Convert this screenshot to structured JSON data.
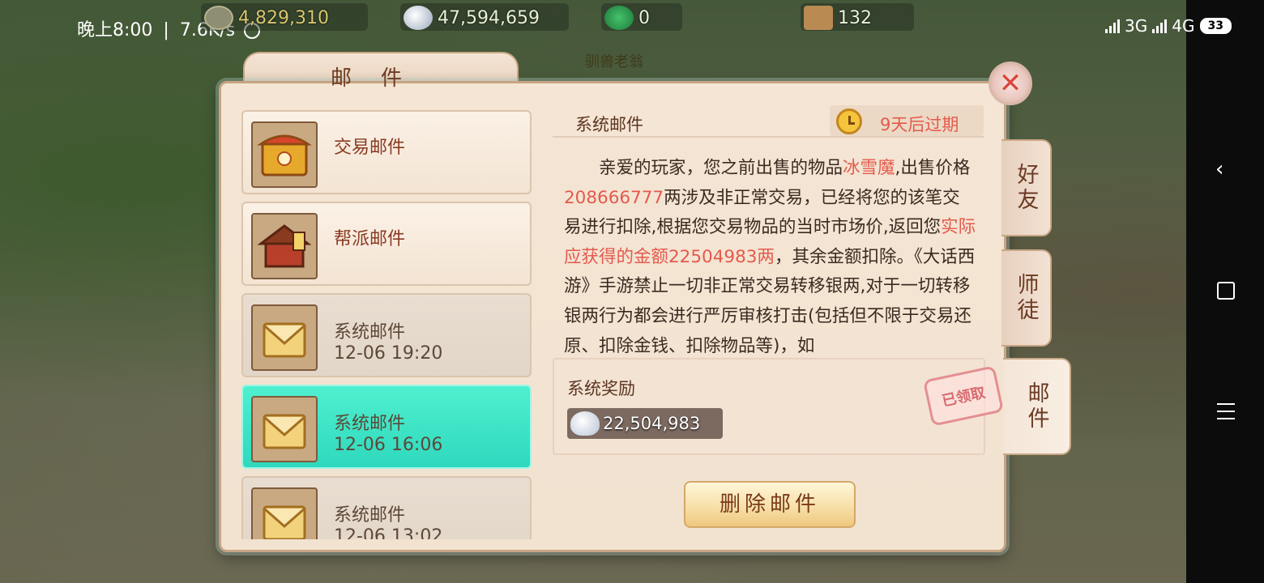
{
  "status_bar": {
    "time": "晚上8:00",
    "separator": "|",
    "speed": "7.6K/s",
    "net1": "3G",
    "net2": "4G",
    "battery": "33"
  },
  "currencies": [
    {
      "icon": "coin-icon",
      "value": "4,829,310"
    },
    {
      "icon": "silver-ingot-icon",
      "value": "47,594,659"
    },
    {
      "icon": "jade-icon",
      "value": "0"
    },
    {
      "icon": "ticket-icon",
      "value": "132"
    }
  ],
  "npc_label": "驯兽老翁",
  "dialog": {
    "title": "邮件"
  },
  "mail_list": [
    {
      "title": "交易邮件",
      "date": "",
      "state": "unread",
      "icon": "treasure-chest-icon"
    },
    {
      "title": "帮派邮件",
      "date": "",
      "state": "unread",
      "icon": "guild-house-icon"
    },
    {
      "title": "系统邮件",
      "date": "12-06 19:20",
      "state": "read",
      "icon": "envelope-icon"
    },
    {
      "title": "系统邮件",
      "date": "12-06 16:06",
      "state": "selected",
      "icon": "envelope-icon"
    },
    {
      "title": "系统邮件",
      "date": "12-06 13:02",
      "state": "read",
      "icon": "envelope-icon"
    }
  ],
  "mail_detail": {
    "title": "系统邮件",
    "expire": "9天后过期",
    "body_segments": [
      {
        "text": "亲爱的玩家，您之前出售的物品",
        "highlight": false
      },
      {
        "text": "冰雪魔",
        "highlight": true
      },
      {
        "text": ",出售价格",
        "highlight": false
      },
      {
        "text": "208666777",
        "highlight": true
      },
      {
        "text": "两涉及非正常交易，已经将您的该笔交易进行扣除,根据您交易物品的当时市场价,返回您",
        "highlight": false
      },
      {
        "text": "实际应获得的金额22504983两",
        "highlight": true
      },
      {
        "text": "，其余金额扣除。《大话西游》手游禁止一切非正常交易转移银两,对于一切转移银两行为都会进行严厉审核打击(包括但不限于交易还原、扣除金钱、扣除物品等)，如",
        "highlight": false
      }
    ],
    "reward_title": "系统奖励",
    "reward_amount": "22,504,983",
    "claimed_stamp": "已领取",
    "delete_label": "删除邮件"
  },
  "side_tabs": [
    {
      "label": "好友",
      "active": false
    },
    {
      "label": "师徒",
      "active": false
    },
    {
      "label": "邮件",
      "active": true
    }
  ],
  "colors": {
    "highlight": "#e45a4d",
    "selected_item": "#3ee0c4",
    "panel_bg": "#f3e4d3"
  }
}
